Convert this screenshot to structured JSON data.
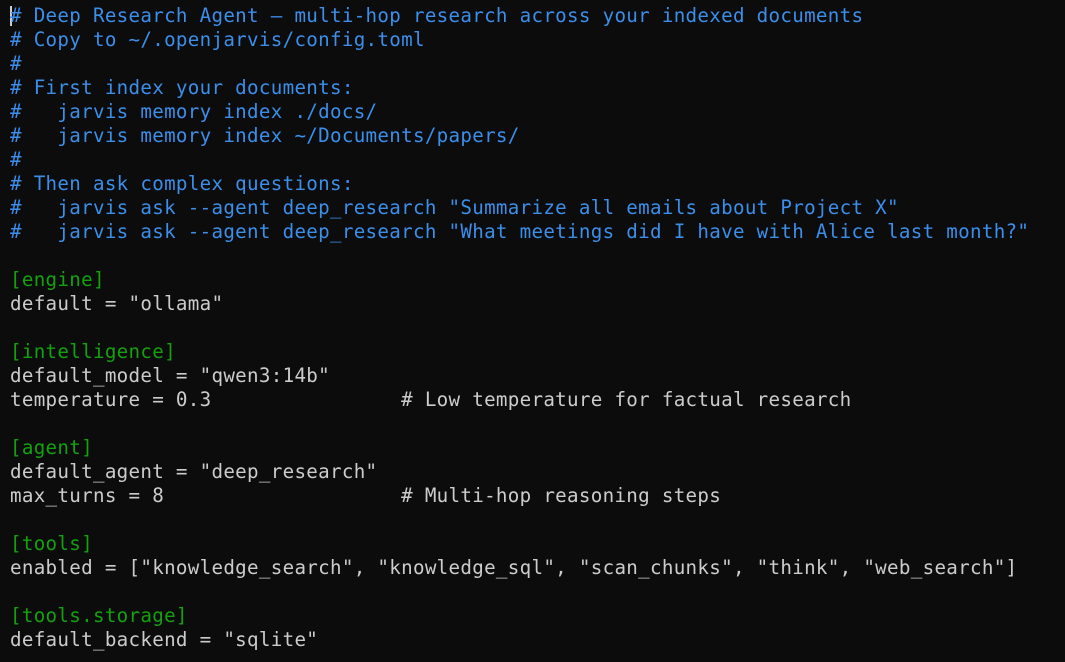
{
  "colors": {
    "background": "#0c0c0c",
    "comment": "#3b8eea",
    "section": "#13a10e",
    "plain": "#cccccc"
  },
  "lines": [
    {
      "kind": "comment",
      "text": "# Deep Research Agent — multi-hop research across your indexed documents"
    },
    {
      "kind": "comment",
      "text": "# Copy to ~/.openjarvis/config.toml"
    },
    {
      "kind": "comment",
      "text": "#"
    },
    {
      "kind": "comment",
      "text": "# First index your documents:"
    },
    {
      "kind": "comment",
      "text": "#   jarvis memory index ./docs/"
    },
    {
      "kind": "comment",
      "text": "#   jarvis memory index ~/Documents/papers/"
    },
    {
      "kind": "comment",
      "text": "#"
    },
    {
      "kind": "comment",
      "text": "# Then ask complex questions:"
    },
    {
      "kind": "comment",
      "text": "#   jarvis ask --agent deep_research \"Summarize all emails about Project X\""
    },
    {
      "kind": "comment",
      "text": "#   jarvis ask --agent deep_research \"What meetings did I have with Alice last month?\""
    },
    {
      "kind": "blank",
      "text": ""
    },
    {
      "kind": "section",
      "text": "[engine]"
    },
    {
      "kind": "plain",
      "text": "default = \"ollama\""
    },
    {
      "kind": "blank",
      "text": ""
    },
    {
      "kind": "section",
      "text": "[intelligence]"
    },
    {
      "kind": "plain",
      "text": "default_model = \"qwen3:14b\""
    },
    {
      "kind": "plain",
      "text": "temperature = 0.3                # Low temperature for factual research"
    },
    {
      "kind": "blank",
      "text": ""
    },
    {
      "kind": "section",
      "text": "[agent]"
    },
    {
      "kind": "plain",
      "text": "default_agent = \"deep_research\""
    },
    {
      "kind": "plain",
      "text": "max_turns = 8                    # Multi-hop reasoning steps"
    },
    {
      "kind": "blank",
      "text": ""
    },
    {
      "kind": "section",
      "text": "[tools]"
    },
    {
      "kind": "plain",
      "text": "enabled = [\"knowledge_search\", \"knowledge_sql\", \"scan_chunks\", \"think\", \"web_search\"]"
    },
    {
      "kind": "blank",
      "text": ""
    },
    {
      "kind": "section",
      "text": "[tools.storage]"
    },
    {
      "kind": "plain",
      "text": "default_backend = \"sqlite\""
    }
  ]
}
